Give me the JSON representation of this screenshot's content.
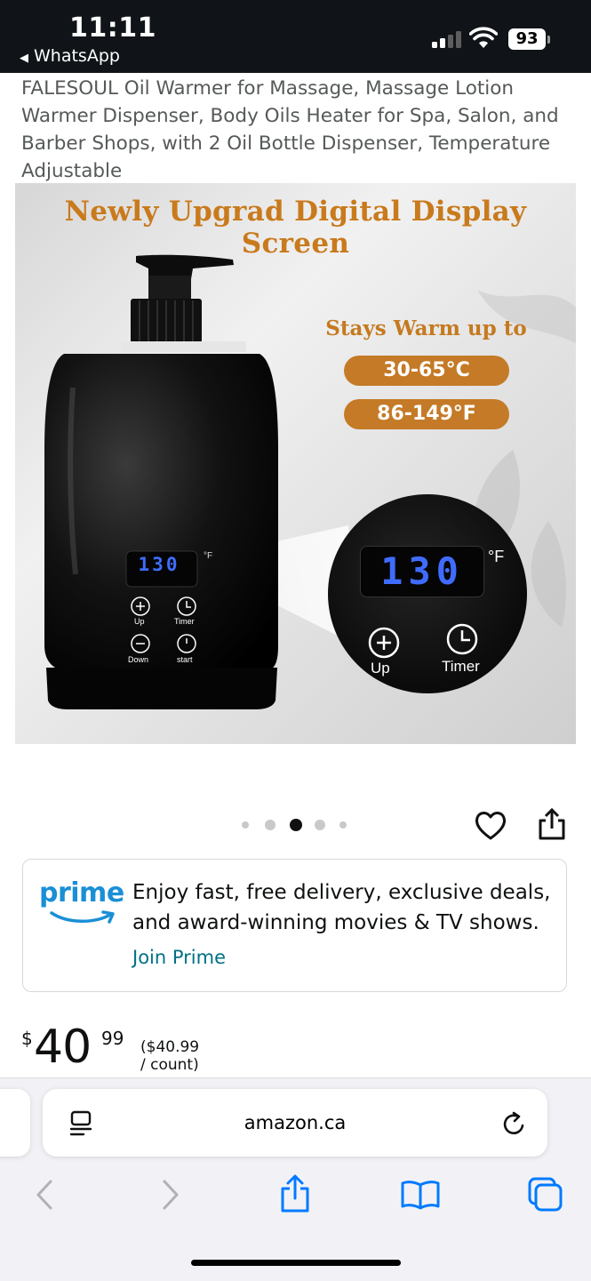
{
  "status_bar": {
    "time": "11:11",
    "back_app": "WhatsApp",
    "battery": "93"
  },
  "product": {
    "title": "FALESOUL Oil Warmer for Massage, Massage Lotion Warmer Dispenser, Body Oils Heater for Spa, Salon, and Barber Shops, with 2 Oil Bottle Dispenser, Temperature Adjustable"
  },
  "image": {
    "headline": "Newly Upgrad Digital Display Screen",
    "stays_warm": "Stays Warm up to",
    "temp_c": "30-65°C",
    "temp_f": "86-149°F",
    "display_value": "130",
    "unit": "°F",
    "btn_up": "Up",
    "btn_timer": "Timer",
    "btn_down": "Down",
    "btn_start": "start",
    "carousel_total": 5,
    "carousel_active": 3
  },
  "prime": {
    "logo": "prime",
    "text": "Enjoy fast, free delivery, exclusive deals, and award-winning movies & TV shows.",
    "join_label": "Join Prime",
    "color": "#1a8fd6"
  },
  "price": {
    "symbol": "$",
    "whole": "40",
    "fraction": "99",
    "unit_price": "($40.99 / count)"
  },
  "browser": {
    "url": "amazon.ca",
    "icons": [
      "reader-icon",
      "reload-icon",
      "back-icon",
      "forward-icon",
      "share-icon",
      "bookmarks-icon",
      "tabs-icon"
    ]
  },
  "colors": {
    "accent_orange": "#c47a26",
    "link": "#007185",
    "safari_blue": "#007aff"
  }
}
